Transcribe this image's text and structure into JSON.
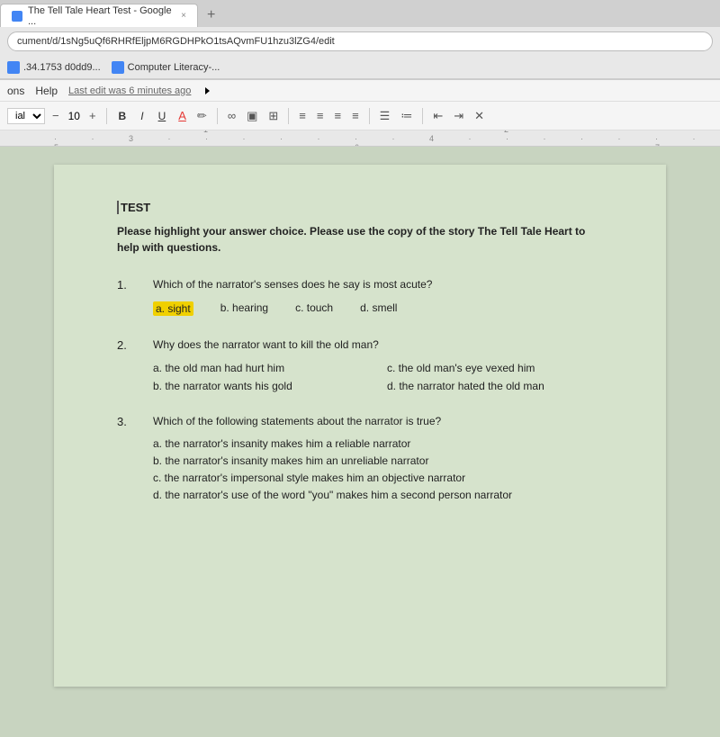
{
  "browser": {
    "tab_label": "The Tell Tale Heart Test - Google ...",
    "tab_close": "×",
    "new_tab": "+",
    "address": "cument/d/1sNg5uQf6RHRfEljpM6RGDHPkO1tsAQvmFU1hzu3lZG4/edit",
    "bookmark1_label": ".34.1753 d0dd9...",
    "bookmark2_label": "Computer Literacy-..."
  },
  "menubar": {
    "items": [
      "ons",
      "Help"
    ],
    "last_edit": "Last edit was 6 minutes ago"
  },
  "toolbar": {
    "font_name": "ial",
    "font_size": "10",
    "bold": "B",
    "italic": "I",
    "underline": "U",
    "align_left": "≡",
    "align_center": "≡",
    "align_right": "≡",
    "justify": "≡"
  },
  "document": {
    "test_title": "TEST",
    "instructions": "Please highlight your answer choice.  Please use the copy of the story The Tell Tale Heart to help with questions.",
    "questions": [
      {
        "number": "1.",
        "text": "Which of the narrator's senses does he say is most acute?",
        "options": [
          {
            "label": "a. sight",
            "highlighted": true
          },
          {
            "label": "b. hearing",
            "highlighted": false
          },
          {
            "label": "c. touch",
            "highlighted": false
          },
          {
            "label": "d. smell",
            "highlighted": false
          }
        ],
        "layout": "row"
      },
      {
        "number": "2.",
        "text": "Why does the narrator want to kill the old man?",
        "options": [
          {
            "label": "a. the old man had hurt him",
            "highlighted": false
          },
          {
            "label": "c. the old man's eye vexed him",
            "highlighted": false
          },
          {
            "label": "b. the narrator wants his gold",
            "highlighted": false
          },
          {
            "label": "d. the narrator hated the old man",
            "highlighted": false
          }
        ],
        "layout": "grid"
      },
      {
        "number": "3.",
        "text": "Which of the following statements about the narrator is true?",
        "options": [
          {
            "label": "a. the narrator's insanity makes him a reliable narrator",
            "highlighted": false
          },
          {
            "label": "b. the narrator's insanity makes him an unreliable narrator",
            "highlighted": false
          },
          {
            "label": "c. the narrator's impersonal style makes him an objective narrator",
            "highlighted": false
          },
          {
            "label": "d. the narrator's use of the word \"you\" makes him a second person narrator",
            "highlighted": false
          }
        ],
        "layout": "list"
      }
    ]
  }
}
